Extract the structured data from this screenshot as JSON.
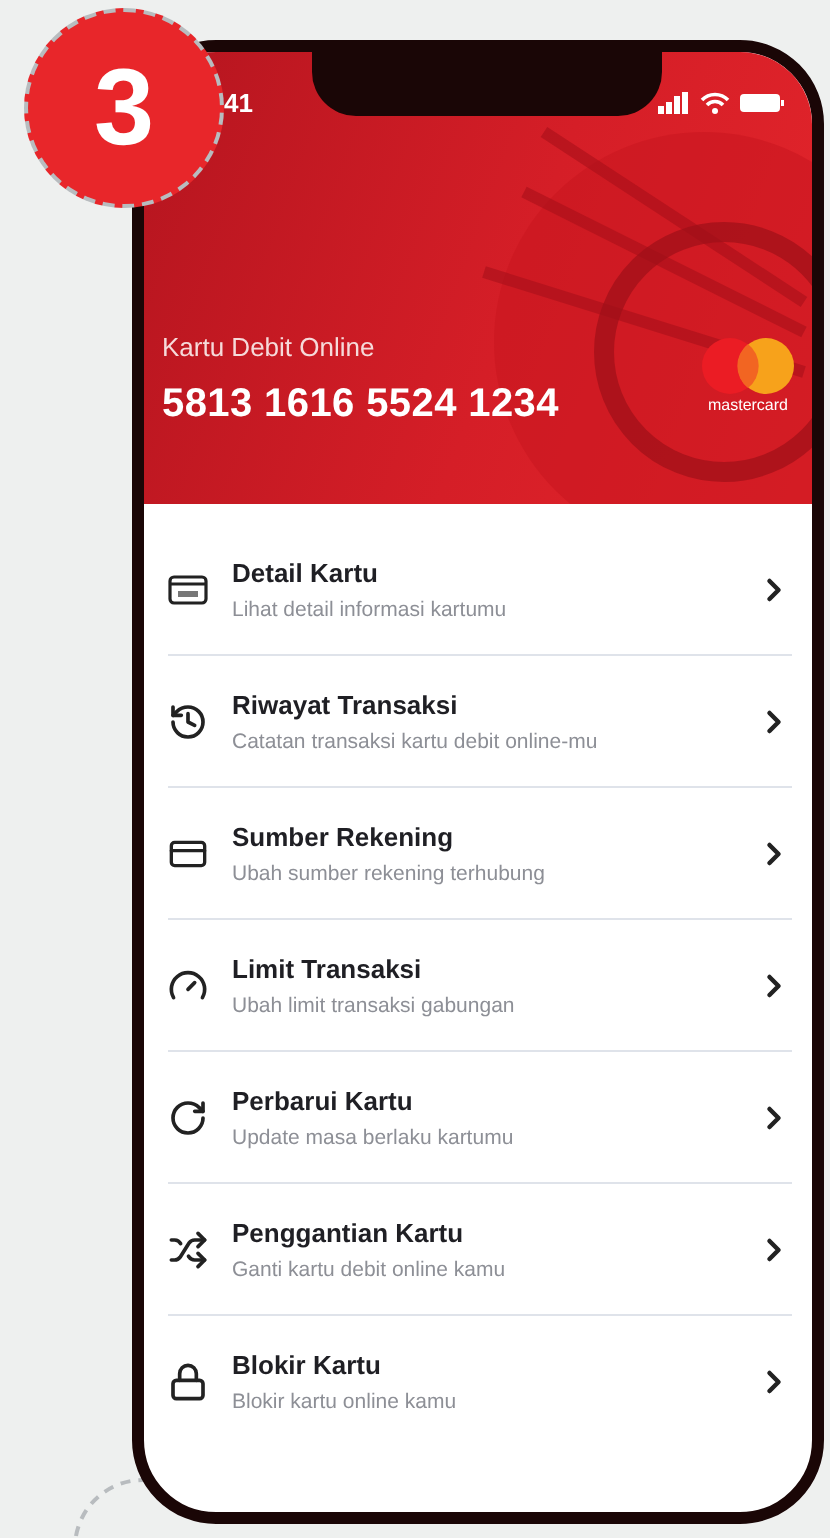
{
  "step_badge": "3",
  "status_bar": {
    "time": "41"
  },
  "card": {
    "label": "Kartu Debit Online",
    "number": "5813 1616 5524 1234",
    "brand": "mastercard"
  },
  "menu": [
    {
      "title": "Detail Kartu",
      "subtitle": "Lihat detail informasi kartumu"
    },
    {
      "title": "Riwayat Transaksi",
      "subtitle": "Catatan transaksi kartu debit online-mu"
    },
    {
      "title": "Sumber Rekening",
      "subtitle": "Ubah sumber rekening terhubung"
    },
    {
      "title": "Limit Transaksi",
      "subtitle": "Ubah limit transaksi gabungan"
    },
    {
      "title": "Perbarui Kartu",
      "subtitle": "Update masa berlaku kartumu"
    },
    {
      "title": "Penggantian Kartu",
      "subtitle": "Ganti kartu debit online kamu"
    },
    {
      "title": "Blokir Kartu",
      "subtitle": "Blokir kartu online kamu"
    }
  ]
}
